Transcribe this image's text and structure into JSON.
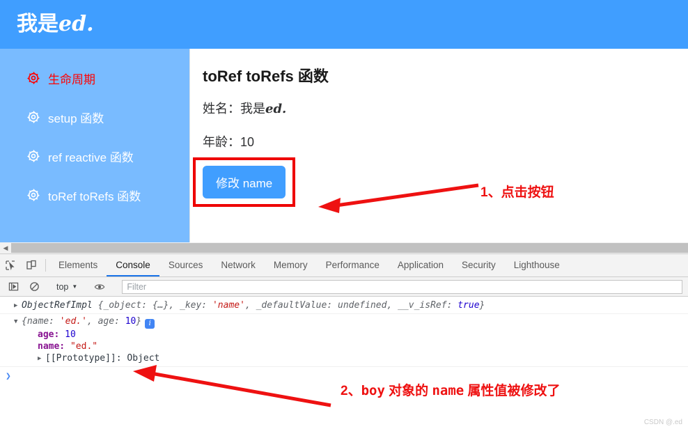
{
  "page": {
    "header": {
      "title_cjk": "我是",
      "title_latin": "ed."
    },
    "sidebar": {
      "items": [
        {
          "label": "生命周期",
          "icon": "gear-icon",
          "active": true
        },
        {
          "label": "setup 函数",
          "icon": "gear-icon",
          "active": false
        },
        {
          "label": "ref reactive 函数",
          "icon": "gear-icon",
          "active": false
        },
        {
          "label": "toRef toRefs 函数",
          "icon": "gear-icon",
          "active": false
        }
      ],
      "active_color": "#ff0000",
      "background": "#79bbff"
    },
    "content": {
      "title": "toRef toRefs 函数",
      "name_label": "姓名：",
      "name_value_cjk": "我是",
      "name_value_latin": "ed.",
      "age_label": "年龄：",
      "age_value": "10",
      "button_label": "修改 name",
      "button_color": "#409eff",
      "highlight_color": "#ee0000"
    }
  },
  "devtools": {
    "tabs": [
      {
        "label": "Elements",
        "active": false
      },
      {
        "label": "Console",
        "active": true
      },
      {
        "label": "Sources",
        "active": false
      },
      {
        "label": "Network",
        "active": false
      },
      {
        "label": "Memory",
        "active": false
      },
      {
        "label": "Performance",
        "active": false
      },
      {
        "label": "Application",
        "active": false
      },
      {
        "label": "Security",
        "active": false
      },
      {
        "label": "Lighthouse",
        "active": false
      }
    ],
    "active_tab_underline": "#1a73e8",
    "console_toolbar": {
      "context_label": "top",
      "context_caret": "▼",
      "filter_placeholder": "Filter"
    },
    "console": {
      "line1": {
        "triangle": "▶",
        "class_name": "ObjectRefImpl",
        "open": "{",
        "k1": "_object:",
        "v1": "{…}",
        "k2": "_key:",
        "v2": "'name'",
        "k3": "_defaultValue:",
        "v3": "undefined",
        "k4": "__v_isRef:",
        "v4": "true",
        "close": "}"
      },
      "line2": {
        "triangle": "▼",
        "summary_open": "{",
        "summary_k1": "name:",
        "summary_v1": "'ed.'",
        "summary_k2": "age:",
        "summary_v2": "10",
        "summary_close": "}",
        "info_badge": "i",
        "rows": [
          {
            "key": "age:",
            "value": "10",
            "value_kind": "number"
          },
          {
            "key": "name:",
            "value": "\"ed.\"",
            "value_kind": "string"
          }
        ],
        "prototype_triangle": "▶",
        "prototype_label": "[[Prototype]]:",
        "prototype_value": "Object"
      },
      "prompt": "❯"
    }
  },
  "annotations": [
    {
      "id": "1",
      "prefix": "1、",
      "text": "点击按钮"
    },
    {
      "id": "2",
      "prefix": "2、",
      "mono": "boy",
      "mid": " 对象的 ",
      "mono2": "name",
      "tail": " 属性值被修改了"
    }
  ],
  "watermark": "CSDN @.ed"
}
